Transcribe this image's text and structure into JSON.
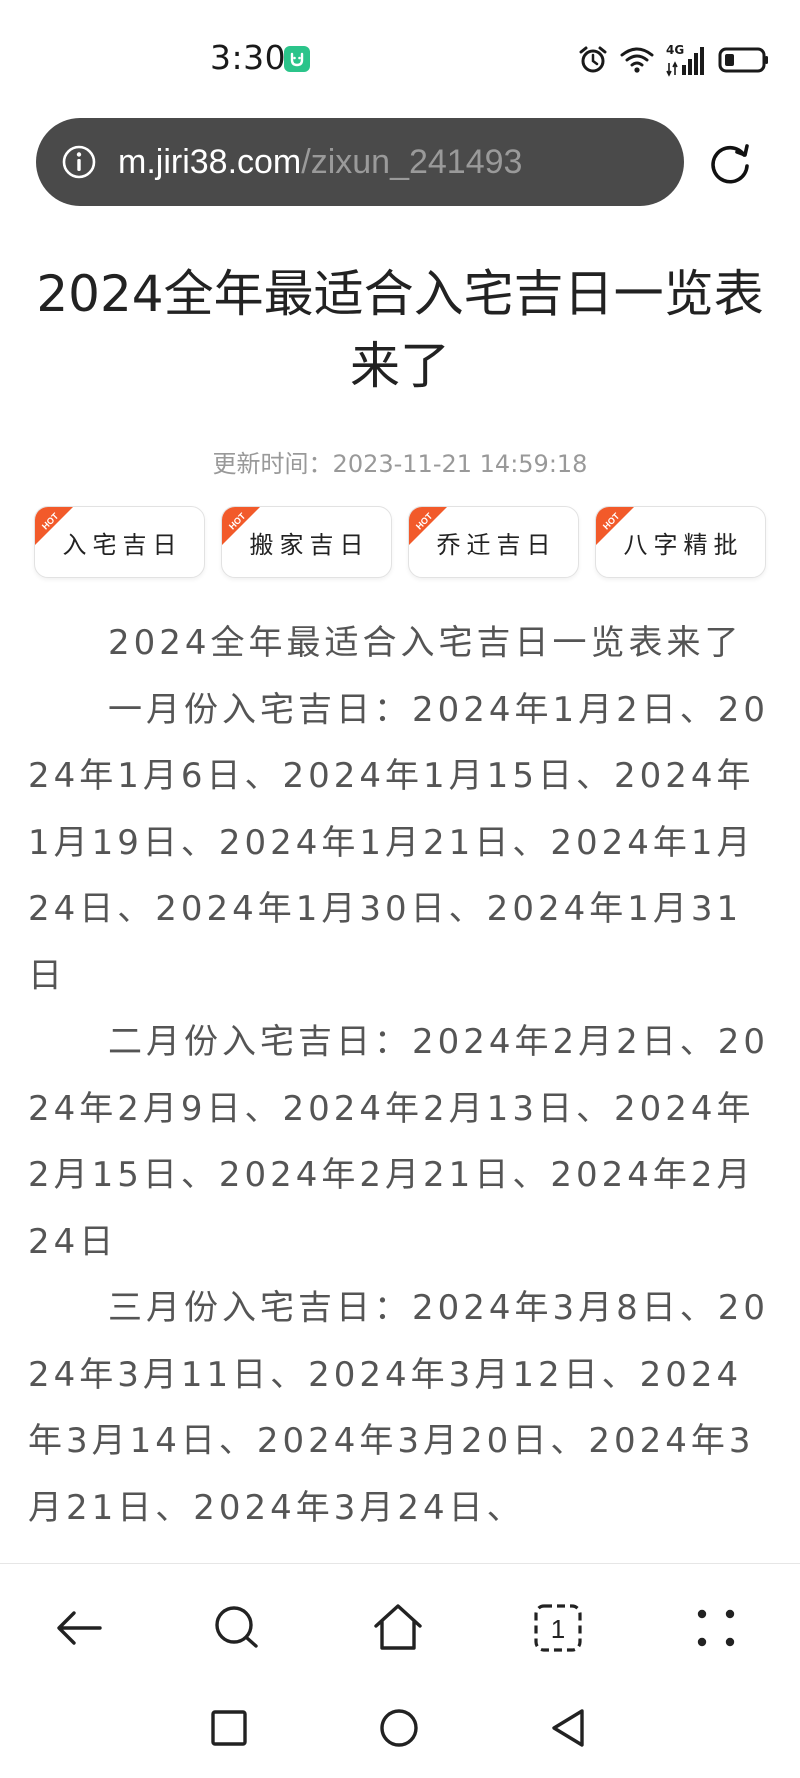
{
  "status_bar": {
    "time": "3:30",
    "network_label": "4G",
    "icons": [
      "alarm-icon",
      "wifi-icon",
      "signal-icon",
      "battery-icon"
    ]
  },
  "url_bar": {
    "host": "m.jiri38.com",
    "path": "/zixun_241493"
  },
  "article": {
    "title": "2024全年最适合入宅吉日一览表来了",
    "update_time": "更新时间：2023-11-21 14:59:18",
    "tags": [
      {
        "label": "入宅吉日",
        "badge": "HOT"
      },
      {
        "label": "搬家吉日",
        "badge": "HOT"
      },
      {
        "label": "乔迁吉日",
        "badge": "HOT"
      },
      {
        "label": "八字精批",
        "badge": "HOT"
      }
    ],
    "paragraphs": [
      "2024全年最适合入宅吉日一览表来了",
      "一月份入宅吉日：2024年1月2日、2024年1月6日、2024年1月15日、2024年1月19日、2024年1月21日、2024年1月24日、2024年1月30日、2024年1月31日",
      "二月份入宅吉日：2024年2月2日、2024年2月9日、2024年2月13日、2024年2月15日、2024年2月21日、2024年2月24日",
      "三月份入宅吉日：2024年3月8日、2024年3月11日、2024年3月12日、2024年3月14日、2024年3月20日、2024年3月21日、2024年3月24日、"
    ]
  },
  "toolbar": {
    "tab_count": "1"
  },
  "colors": {
    "url_bar_bg": "#4a4a4a",
    "hot_badge": "#f25a2a",
    "app_icon": "#2bc48a"
  }
}
